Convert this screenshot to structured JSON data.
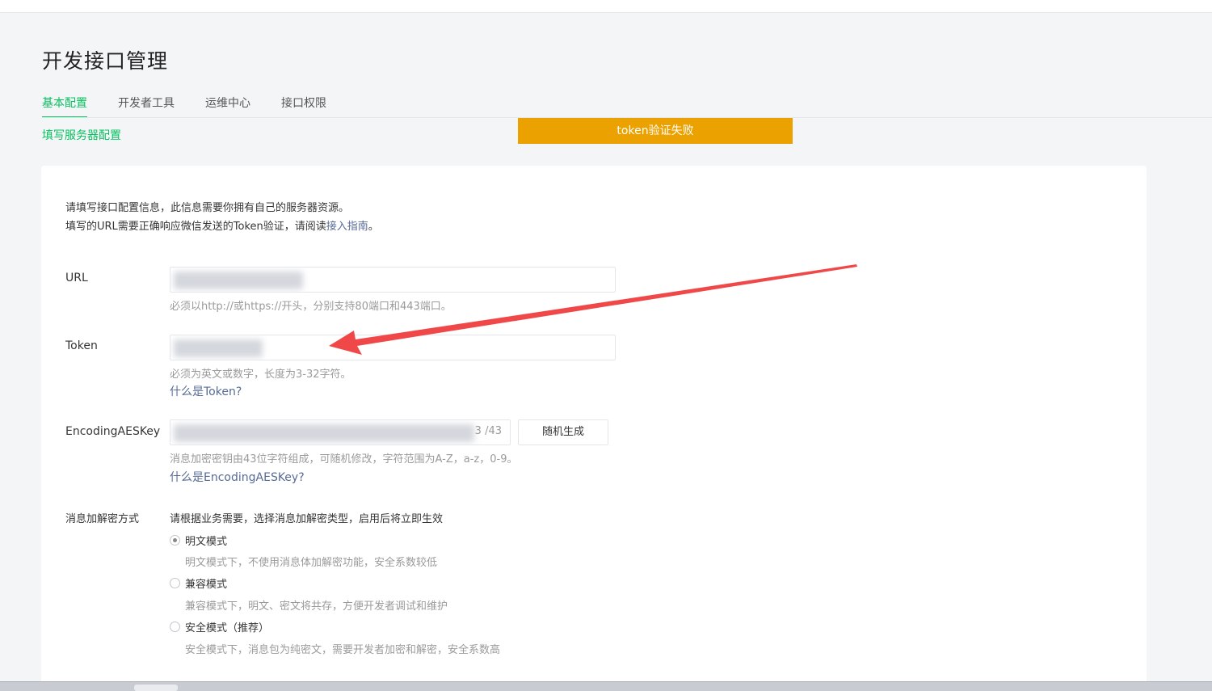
{
  "page": {
    "title": "开发接口管理"
  },
  "tabs": [
    {
      "label": "基本配置",
      "active": true
    },
    {
      "label": "开发者工具",
      "active": false
    },
    {
      "label": "运维中心",
      "active": false
    },
    {
      "label": "接口权限",
      "active": false
    }
  ],
  "subnav": {
    "label": "填写服务器配置"
  },
  "toast": {
    "text": "token验证失败",
    "color": "#eba100"
  },
  "intro": {
    "line1": "请填写接口配置信息，此信息需要你拥有自己的服务器资源。",
    "line2_prefix": "填写的URL需要正确响应微信发送的Token验证，请阅读",
    "line2_link": "接入指南",
    "line2_suffix": "。"
  },
  "form": {
    "url": {
      "label": "URL",
      "hint": "必须以http://或https://开头，分别支持80端口和443端口。"
    },
    "token": {
      "label": "Token",
      "hint": "必须为英文或数字，长度为3-32字符。",
      "help_link": "什么是Token?"
    },
    "aeskey": {
      "label": "EncodingAESKey",
      "counter": "3 /43",
      "button": "随机生成",
      "hint": "消息加密密钥由43位字符组成，可随机修改，字符范围为A-Z，a-z，0-9。",
      "help_link": "什么是EncodingAESKey?"
    },
    "encryption": {
      "label": "消息加解密方式",
      "hint": "请根据业务需要，选择消息加解密类型，启用后将立即生效",
      "options": [
        {
          "label": "明文模式",
          "desc": "明文模式下，不使用消息体加解密功能，安全系数较低",
          "checked": true
        },
        {
          "label": "兼容模式",
          "desc": "兼容模式下，明文、密文将共存，方便开发者调试和维护",
          "checked": false
        },
        {
          "label": "安全模式（推荐）",
          "desc": "安全模式下，消息包为纯密文，需要开发者加密和解密，安全系数高",
          "checked": false
        }
      ]
    }
  },
  "colors": {
    "accent": "#07c160",
    "link": "#576b95",
    "annotation_arrow": "#f04848"
  }
}
